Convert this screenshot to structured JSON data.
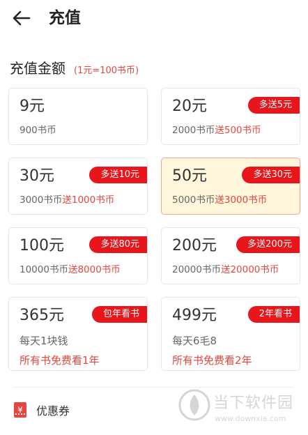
{
  "header": {
    "back_icon": "arrow-left-icon",
    "title": "充值"
  },
  "section": {
    "title": "充值金额",
    "hint": "(1元=100书币)"
  },
  "options": [
    {
      "price": "9元",
      "base": "900书币",
      "bonus": "",
      "badge": ""
    },
    {
      "price": "20元",
      "base": "2000书币",
      "bonus": "送500书币",
      "badge": "多送5元"
    },
    {
      "price": "30元",
      "base": "3000书币",
      "bonus": "送1000书币",
      "badge": "多送10元"
    },
    {
      "price": "50元",
      "base": "5000书币",
      "bonus": "送3000书币",
      "badge": "多送30元",
      "selected": true
    },
    {
      "price": "100元",
      "base": "10000书币",
      "bonus": "送8000书币",
      "badge": "多送80元"
    },
    {
      "price": "200元",
      "base": "20000书币",
      "bonus": "送20000书币",
      "badge": "多送200元"
    }
  ],
  "plans": [
    {
      "price": "365元",
      "line2": "每天1块钱",
      "line3": "所有书免费看1年",
      "badge": "包年看书"
    },
    {
      "price": "499元",
      "line2": "每天6毛8",
      "line3": "所有书免费看2年",
      "badge": "2年看书"
    }
  ],
  "coupon": {
    "icon": "coupon-icon",
    "icon_glyph": "¥",
    "label": "优惠券"
  },
  "watermark": {
    "text": "当下软件园",
    "url": "www.downxia.com"
  },
  "colors": {
    "accent": "#e8453c",
    "badge": "#e8151b",
    "selected_bg": "#fff6dc"
  }
}
